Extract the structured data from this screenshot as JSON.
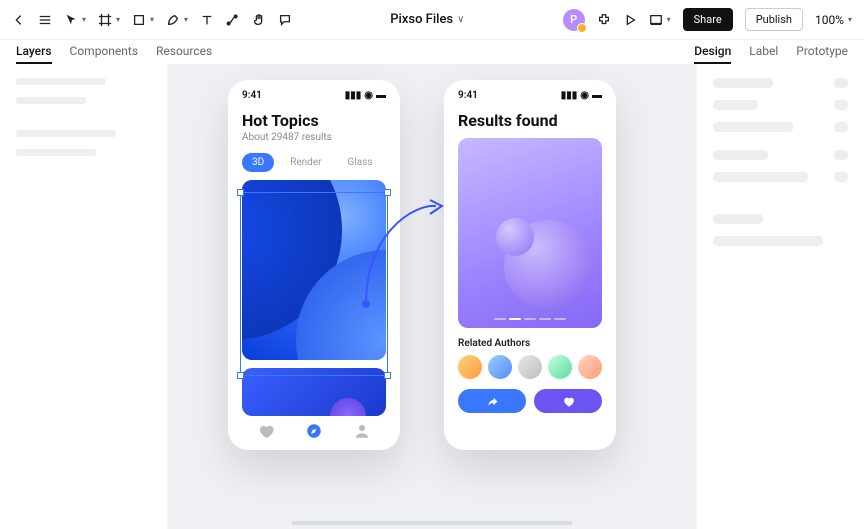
{
  "toolbar": {
    "title": "Pixso Files",
    "share": "Share",
    "publish": "Publish",
    "zoom": "100%",
    "avatar_letter": "P"
  },
  "left_tabs": {
    "layers": "Layers",
    "components": "Components",
    "resources": "Resources"
  },
  "right_tabs": {
    "design": "Design",
    "label": "Label",
    "prototype": "Prototype"
  },
  "phone1": {
    "time": "9:41",
    "title": "Hot Topics",
    "subtitle": "About 29487 results",
    "filters": {
      "f1": "3D",
      "f2": "Render",
      "f3": "Glass"
    }
  },
  "phone2": {
    "time": "9:41",
    "title": "Results found",
    "related": "Related Authors"
  }
}
